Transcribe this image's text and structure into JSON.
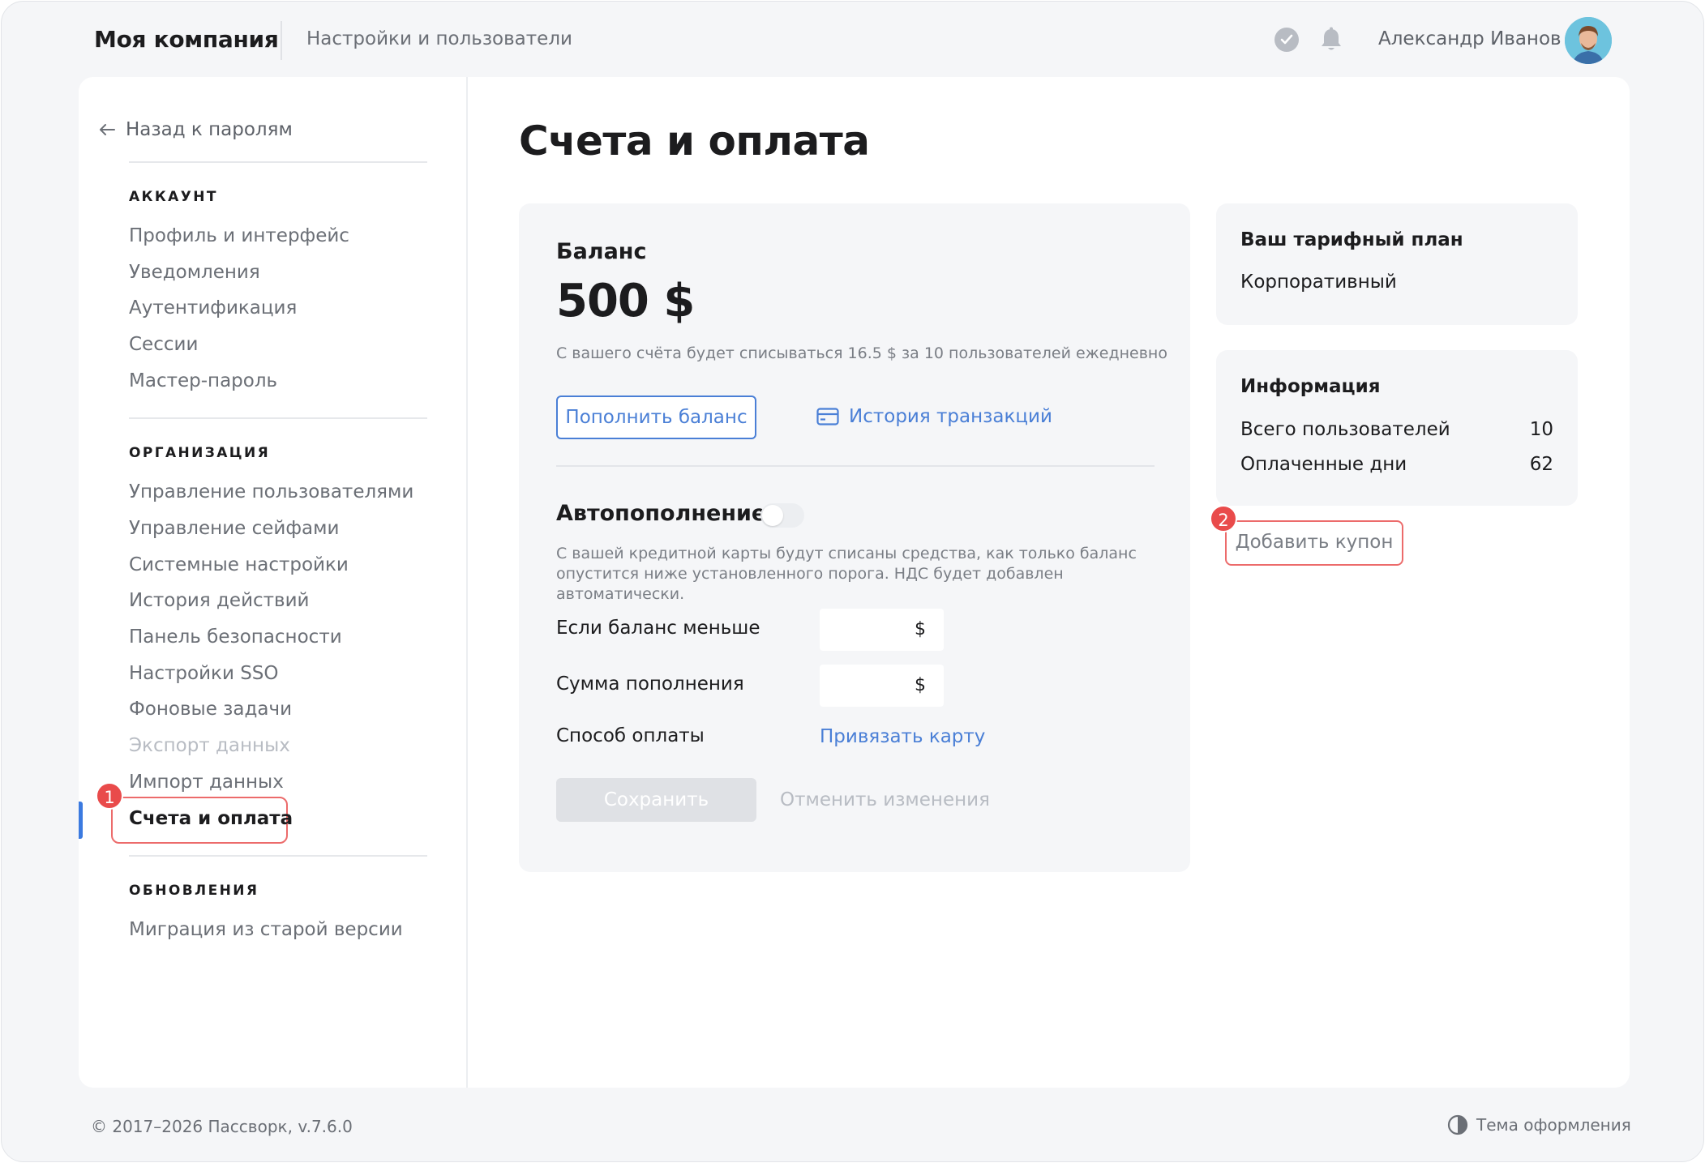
{
  "header": {
    "brand": "Моя компания",
    "section": "Настройки и пользователи",
    "user_name": "Александр Иванов",
    "icons": [
      "check-circle-icon",
      "bell-icon"
    ]
  },
  "sidebar": {
    "back_label": "Назад к паролям",
    "account_heading": "АККАУНТ",
    "account_items": [
      "Профиль и интерфейс",
      "Уведомления",
      "Аутентификация",
      "Сессии",
      "Мастер-пароль"
    ],
    "org_heading": "ОРГАНИЗАЦИЯ",
    "org_items": [
      "Управление пользователями",
      "Управление сейфами",
      "Системные настройки",
      "История действий",
      "Панель безопасности",
      "Настройки SSO",
      "Фоновые задачи",
      "Экспорт данных",
      "Импорт данных",
      "Счета и оплата"
    ],
    "updates_heading": "ОБНОВЛЕНИЯ",
    "updates_items": [
      "Миграция из старой версии"
    ],
    "active_item": "Счета и оплата"
  },
  "main": {
    "title": "Счета и оплата",
    "balance": {
      "label": "Баланс",
      "amount": "500 $",
      "note": "С вашего счёта будет списываться 16.5 $ за 10 пользователей ежедневно",
      "topup_button": "Пополнить баланс",
      "history_link": "История транзакций"
    },
    "autopay": {
      "title": "Автопополнение",
      "enabled": false,
      "description": "С вашей кредитной карты будут списаны средства, как только баланс опустится ниже установленного порога. НДС будет добавлен автоматически.",
      "threshold_label": "Если баланс меньше",
      "threshold_currency": "$",
      "amount_label": "Сумма пополнения",
      "amount_currency": "$",
      "method_label": "Способ оплаты",
      "method_link": "Привязать карту"
    },
    "save_button": "Сохранить",
    "cancel_button": "Отменить изменения"
  },
  "plan": {
    "title": "Ваш тарифный план",
    "value": "Корпоративный"
  },
  "info": {
    "title": "Информация",
    "rows": [
      {
        "label": "Всего пользователей",
        "value": "10"
      },
      {
        "label": "Оплаченные дни",
        "value": "62"
      }
    ]
  },
  "coupon_button": "Добавить купон",
  "annotations": [
    "1",
    "2"
  ],
  "footer": {
    "copyright": "© 2017–2026 Пассворк, v.7.6.0",
    "theme_label": "Тема оформления"
  },
  "colors": {
    "accent": "#4a7fd6",
    "highlight": "#ec6b6b",
    "badge": "#e94b4b"
  }
}
